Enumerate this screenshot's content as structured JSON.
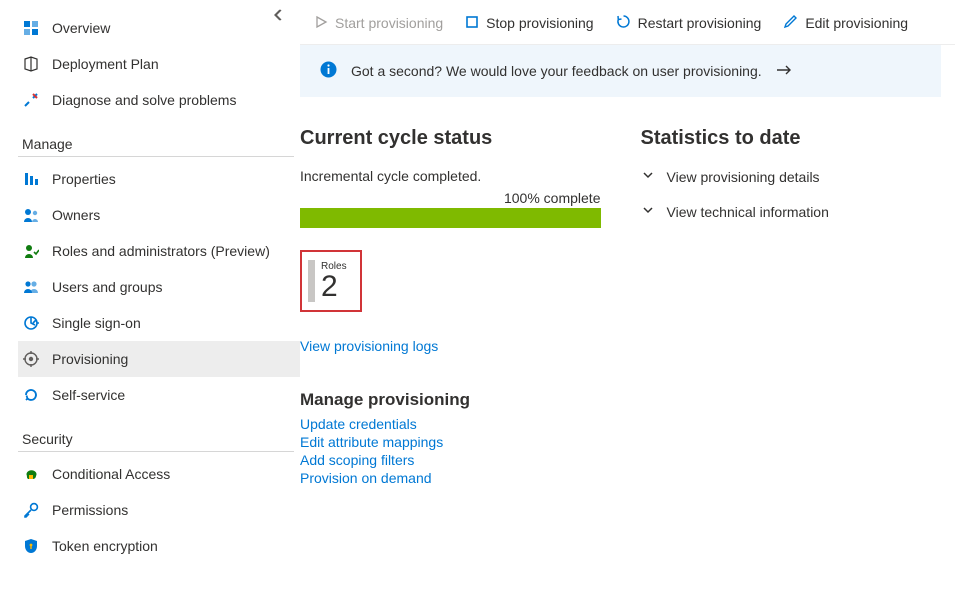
{
  "sidebar": {
    "top": [
      {
        "label": "Overview",
        "name": "sidebar-item-overview",
        "icon": "overview-icon",
        "color": "#0078d4"
      },
      {
        "label": "Deployment Plan",
        "name": "sidebar-item-deployment-plan",
        "icon": "deployment-icon",
        "color": "#323130"
      },
      {
        "label": "Diagnose and solve problems",
        "name": "sidebar-item-diagnose",
        "icon": "diagnose-icon",
        "color": "#0078d4"
      }
    ],
    "section_manage": "Manage",
    "manage": [
      {
        "label": "Properties",
        "name": "sidebar-item-properties",
        "icon": "properties-icon",
        "color": "#0078d4"
      },
      {
        "label": "Owners",
        "name": "sidebar-item-owners",
        "icon": "owners-icon",
        "color": "#0078d4"
      },
      {
        "label": "Roles and administrators (Preview)",
        "name": "sidebar-item-roles",
        "icon": "roles-icon",
        "color": "#107c10"
      },
      {
        "label": "Users and groups",
        "name": "sidebar-item-users-groups",
        "icon": "users-icon",
        "color": "#0078d4"
      },
      {
        "label": "Single sign-on",
        "name": "sidebar-item-sso",
        "icon": "sso-icon",
        "color": "#0078d4"
      },
      {
        "label": "Provisioning",
        "name": "sidebar-item-provisioning",
        "icon": "provisioning-icon",
        "color": "#605e5c",
        "active": true
      },
      {
        "label": "Self-service",
        "name": "sidebar-item-self-service",
        "icon": "self-service-icon",
        "color": "#0078d4"
      }
    ],
    "section_security": "Security",
    "security": [
      {
        "label": "Conditional Access",
        "name": "sidebar-item-conditional-access",
        "icon": "conditional-access-icon",
        "color": "#107c10"
      },
      {
        "label": "Permissions",
        "name": "sidebar-item-permissions",
        "icon": "permissions-icon",
        "color": "#0078d4"
      },
      {
        "label": "Token encryption",
        "name": "sidebar-item-token-encryption",
        "icon": "token-icon",
        "color": "#0078d4"
      }
    ]
  },
  "toolbar": {
    "start": "Start provisioning",
    "stop": "Stop provisioning",
    "restart": "Restart provisioning",
    "edit": "Edit provisioning"
  },
  "banner": {
    "text": "Got a second? We would love your feedback on user provisioning."
  },
  "cycle": {
    "heading": "Current cycle status",
    "status": "Incremental cycle completed.",
    "progress_label": "100% complete",
    "roles_label": "Roles",
    "roles_count": "2",
    "view_logs": "View provisioning logs"
  },
  "manage_prov": {
    "heading": "Manage provisioning",
    "links": [
      "Update credentials",
      "Edit attribute mappings",
      "Add scoping filters",
      "Provision on demand"
    ]
  },
  "stats": {
    "heading": "Statistics to date",
    "details": "View provisioning details",
    "technical": "View technical information"
  }
}
